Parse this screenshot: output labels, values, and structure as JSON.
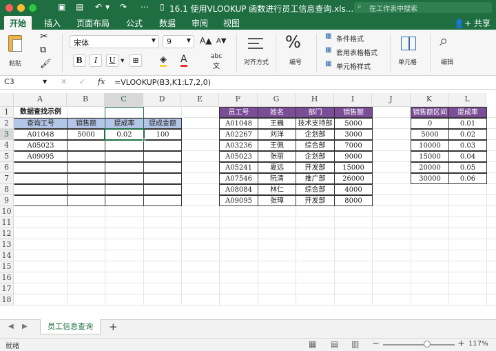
{
  "title_bar": {
    "document_title": "16.1 使用VLOOKUP 函数进行员工信息查询.xls...",
    "search_placeholder": "在工作表中搜索"
  },
  "ribbon_tabs": [
    "开始",
    "插入",
    "页面布局",
    "公式",
    "数据",
    "审阅",
    "视图"
  ],
  "share_label": "共享",
  "ribbon": {
    "paste_label": "粘贴",
    "font_name": "宋体",
    "font_size": "9",
    "bold": "B",
    "italic": "I",
    "underline": "U",
    "align_label": "对齐方式",
    "number_label": "编号",
    "number_symbol": "%",
    "conditional_format": "条件格式",
    "table_format": "套用表格格式",
    "cell_style": "单元格样式",
    "cells_label": "单元格",
    "edit_label": "编辑"
  },
  "formula_bar": {
    "name_box": "C3",
    "fx": "fx",
    "formula": "=VLOOKUP(B3,K1:L7,2,0)"
  },
  "columns": [
    "A",
    "B",
    "C",
    "D",
    "E",
    "F",
    "G",
    "H",
    "I",
    "J",
    "K",
    "L"
  ],
  "rows": [
    "1",
    "2",
    "3",
    "4",
    "5",
    "6",
    "7",
    "8",
    "9",
    "10",
    "11",
    "12",
    "13",
    "14",
    "15",
    "16",
    "17",
    "18"
  ],
  "lookup_table": {
    "title": "数据查找示例",
    "headers": [
      "查询工号",
      "销售额",
      "提成率",
      "提成金额"
    ],
    "rows": [
      [
        "A01048",
        "5000",
        "0.02",
        "100"
      ],
      [
        "A05023",
        "",
        "",
        ""
      ],
      [
        "A09095",
        "",
        "",
        ""
      ],
      [
        "",
        "",
        "",
        ""
      ],
      [
        "",
        "",
        "",
        ""
      ],
      [
        "",
        "",
        "",
        ""
      ],
      [
        "",
        "",
        "",
        ""
      ]
    ]
  },
  "employee_table": {
    "headers": [
      "员工号",
      "姓名",
      "部门",
      "销售额"
    ],
    "rows": [
      [
        "A01048",
        "王巍",
        "技术支持部",
        "5000"
      ],
      [
        "A02267",
        "刘洋",
        "企划部",
        "3000"
      ],
      [
        "A03236",
        "王佩",
        "综合部",
        "7000"
      ],
      [
        "A05023",
        "张丽",
        "企划部",
        "9000"
      ],
      [
        "A05241",
        "夏远",
        "开发部",
        "15000"
      ],
      [
        "A07546",
        "阮清",
        "推广部",
        "26000"
      ],
      [
        "A08084",
        "林仁",
        "综合部",
        "4000"
      ],
      [
        "A09095",
        "张璋",
        "开发部",
        "8000"
      ]
    ]
  },
  "rate_table": {
    "headers": [
      "销售额区间",
      "提成率"
    ],
    "rows": [
      [
        "0",
        "0.01"
      ],
      [
        "5000",
        "0.02"
      ],
      [
        "10000",
        "0.03"
      ],
      [
        "15000",
        "0.04"
      ],
      [
        "20000",
        "0.05"
      ],
      [
        "30000",
        "0.06"
      ]
    ]
  },
  "sheet_tab": "员工信息查询",
  "add_sheet": "+",
  "status": {
    "ready": "就绪",
    "zoom": "117%",
    "zoom_fraction": 0.62
  }
}
